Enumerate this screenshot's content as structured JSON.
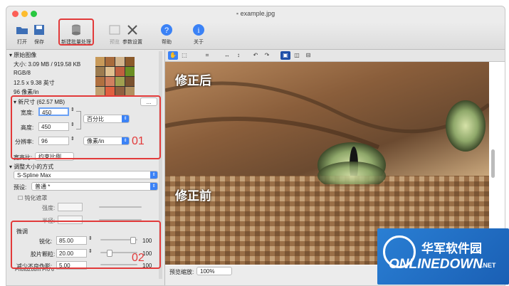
{
  "window": {
    "title": "example.jpg"
  },
  "toolbar": {
    "open": "打开",
    "save": "保存",
    "batch": "新建批量处理",
    "preview": "预览",
    "settings": "参数设置",
    "help": "帮助",
    "about": "关于"
  },
  "original": {
    "header": "原始图像",
    "size": "大小: 3.09 MB / 919.58 KB",
    "mode": "RGB/8",
    "dims": "12.5 x 9.38 英寸",
    "res": "96 像素/in"
  },
  "newsize": {
    "header": "新尺寸 (62.57 MB)",
    "width_label": "宽度:",
    "width_value": "450",
    "height_label": "高度:",
    "height_value": "450",
    "unit": "百分比",
    "res_label": "分辨率:",
    "res_value": "96",
    "res_unit": "像素/in",
    "ratio_label": "宽高比:",
    "ratio_value": "约束比例",
    "button": "..."
  },
  "resize_method": {
    "header": "调整大小的方式",
    "method": "S-Spline Max",
    "preset_label": "预设:",
    "preset_value": "普通 *"
  },
  "unsharp": {
    "header": "钝化遮罩",
    "strength_label": "强度:",
    "radius_label": "半径:"
  },
  "finetune": {
    "header": "微调",
    "sharp_label": "锐化:",
    "sharp_value": "85.00",
    "sharp_max": "100",
    "grain_label": "胶片颗粒:",
    "grain_value": "20.00",
    "grain_max": "100",
    "artifact_label": "减少不良伪影:",
    "artifact_value": "5.00",
    "artifact_max": "100"
  },
  "footer_left": "PhotoZoom Pro 6",
  "annotations": {
    "box1": "01",
    "box2": "02"
  },
  "preview": {
    "after": "修正后",
    "before": "修正前",
    "zoom_label": "预览缩放:",
    "zoom_value": "100%"
  },
  "logo": {
    "cn": "华军软件园",
    "en": "ONLINEDOWN",
    "suffix": ".NET"
  },
  "colors": {
    "red": "#e23a3a",
    "accent": "#3b82f6"
  }
}
